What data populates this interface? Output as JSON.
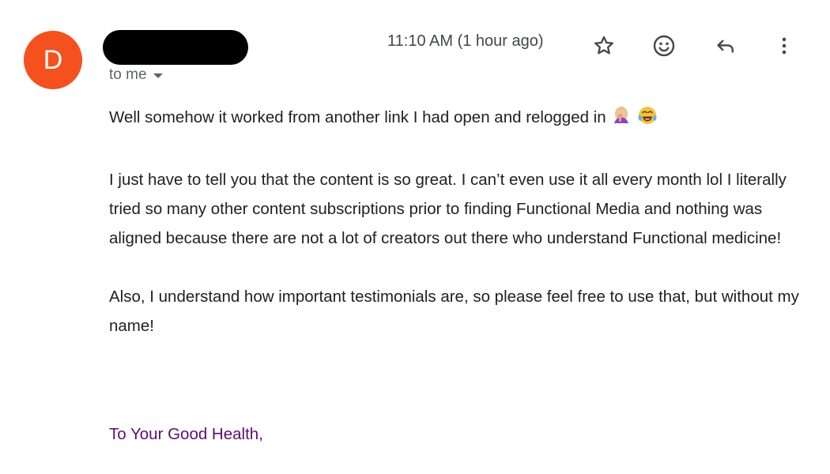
{
  "sender": {
    "avatar_initial": "D",
    "avatar_color": "#f4511e",
    "name_redacted": true
  },
  "recipient": {
    "label": "to me"
  },
  "header": {
    "timestamp": "11:10 AM (1 hour ago)",
    "icons": [
      "star-icon",
      "emoji-reaction-icon",
      "reply-icon",
      "more-options-icon"
    ]
  },
  "message": {
    "paragraph_1": "Well somehow it worked from another link I had open and relogged in",
    "paragraph_1_emojis": [
      "woman-facepalming-emoji",
      "face-with-tears-of-joy-emoji"
    ],
    "paragraph_2": "I just have to tell you that the content is so great. I can’t even use it all every month lol I literally tried so many other content subscriptions prior to finding Functional Media and nothing was aligned because there are not a lot of creators out there who understand Functional medicine!",
    "paragraph_3": "Also, I understand how important testimonials are, so please feel free to use that, but without my name!"
  },
  "signature": {
    "text": "To Your Good Health,",
    "color": "#5e0d6f"
  }
}
